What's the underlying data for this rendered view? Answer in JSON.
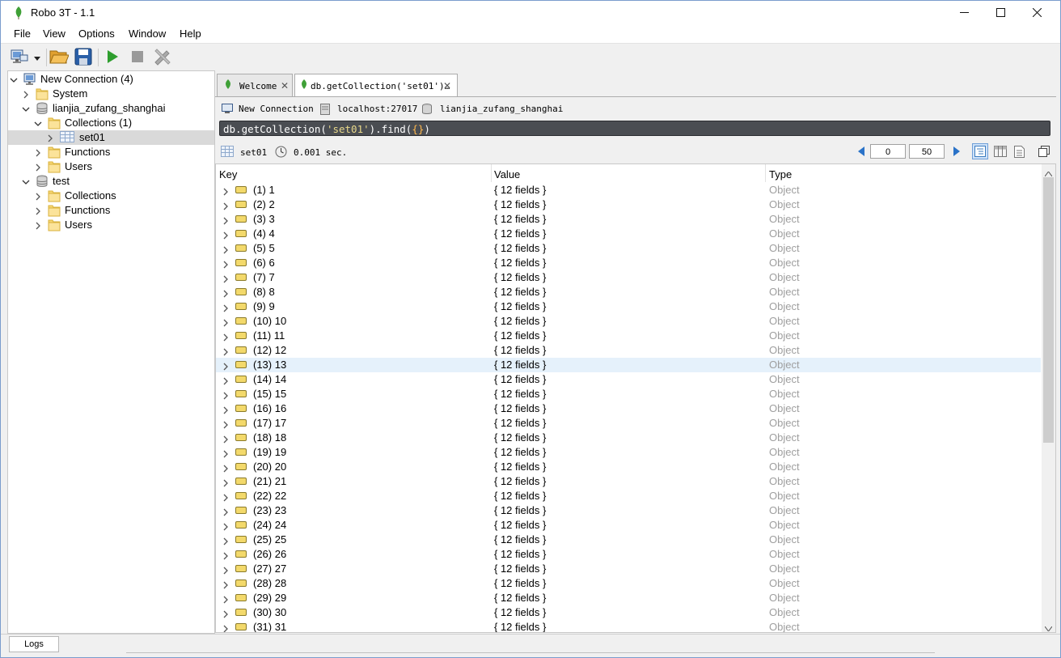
{
  "window": {
    "title": "Robo 3T - 1.1"
  },
  "menu": [
    "File",
    "View",
    "Options",
    "Window",
    "Help"
  ],
  "tree": [
    {
      "label": "New Connection (4)",
      "icon": "server-icon",
      "chev": "down",
      "indent": 0
    },
    {
      "label": "System",
      "icon": "folder-icon",
      "chev": "right",
      "indent": 1
    },
    {
      "label": "lianjia_zufang_shanghai",
      "icon": "database-icon",
      "chev": "down",
      "indent": 1
    },
    {
      "label": "Collections (1)",
      "icon": "folder-icon",
      "chev": "down",
      "indent": 2
    },
    {
      "label": "set01",
      "icon": "collection-icon",
      "chev": "right",
      "indent": 3,
      "selected": true
    },
    {
      "label": "Functions",
      "icon": "folder-icon",
      "chev": "right",
      "indent": 2
    },
    {
      "label": "Users",
      "icon": "folder-icon",
      "chev": "right",
      "indent": 2
    },
    {
      "label": "test",
      "icon": "database-icon",
      "chev": "down",
      "indent": 1
    },
    {
      "label": "Collections",
      "icon": "folder-icon",
      "chev": "right",
      "indent": 2
    },
    {
      "label": "Functions",
      "icon": "folder-icon",
      "chev": "right",
      "indent": 2
    },
    {
      "label": "Users",
      "icon": "folder-icon",
      "chev": "right",
      "indent": 2
    }
  ],
  "tabs": {
    "welcome": "Welcome",
    "query": "db.getCollection('set01')…"
  },
  "breadcrumb": {
    "connection": "New Connection",
    "host": "localhost:27017",
    "database": "lianjia_zufang_shanghai"
  },
  "query": {
    "prefix": "db.getCollection(",
    "collection": "'set01'",
    "suffix": ").find(",
    "cursor": "{}",
    "end": ")"
  },
  "results": {
    "collection": "set01",
    "time": "0.001 sec.",
    "page_start": "0",
    "page_size": "50",
    "columns": [
      "Key",
      "Value",
      "Type"
    ],
    "selected_row": 13,
    "rows": [
      {
        "key": "(1) 1",
        "value": "{ 12 fields }",
        "type": "Object"
      },
      {
        "key": "(2) 2",
        "value": "{ 12 fields }",
        "type": "Object"
      },
      {
        "key": "(3) 3",
        "value": "{ 12 fields }",
        "type": "Object"
      },
      {
        "key": "(4) 4",
        "value": "{ 12 fields }",
        "type": "Object"
      },
      {
        "key": "(5) 5",
        "value": "{ 12 fields }",
        "type": "Object"
      },
      {
        "key": "(6) 6",
        "value": "{ 12 fields }",
        "type": "Object"
      },
      {
        "key": "(7) 7",
        "value": "{ 12 fields }",
        "type": "Object"
      },
      {
        "key": "(8) 8",
        "value": "{ 12 fields }",
        "type": "Object"
      },
      {
        "key": "(9) 9",
        "value": "{ 12 fields }",
        "type": "Object"
      },
      {
        "key": "(10) 10",
        "value": "{ 12 fields }",
        "type": "Object"
      },
      {
        "key": "(11) 11",
        "value": "{ 12 fields }",
        "type": "Object"
      },
      {
        "key": "(12) 12",
        "value": "{ 12 fields }",
        "type": "Object"
      },
      {
        "key": "(13) 13",
        "value": "{ 12 fields }",
        "type": "Object"
      },
      {
        "key": "(14) 14",
        "value": "{ 12 fields }",
        "type": "Object"
      },
      {
        "key": "(15) 15",
        "value": "{ 12 fields }",
        "type": "Object"
      },
      {
        "key": "(16) 16",
        "value": "{ 12 fields }",
        "type": "Object"
      },
      {
        "key": "(17) 17",
        "value": "{ 12 fields }",
        "type": "Object"
      },
      {
        "key": "(18) 18",
        "value": "{ 12 fields }",
        "type": "Object"
      },
      {
        "key": "(19) 19",
        "value": "{ 12 fields }",
        "type": "Object"
      },
      {
        "key": "(20) 20",
        "value": "{ 12 fields }",
        "type": "Object"
      },
      {
        "key": "(21) 21",
        "value": "{ 12 fields }",
        "type": "Object"
      },
      {
        "key": "(22) 22",
        "value": "{ 12 fields }",
        "type": "Object"
      },
      {
        "key": "(23) 23",
        "value": "{ 12 fields }",
        "type": "Object"
      },
      {
        "key": "(24) 24",
        "value": "{ 12 fields }",
        "type": "Object"
      },
      {
        "key": "(25) 25",
        "value": "{ 12 fields }",
        "type": "Object"
      },
      {
        "key": "(26) 26",
        "value": "{ 12 fields }",
        "type": "Object"
      },
      {
        "key": "(27) 27",
        "value": "{ 12 fields }",
        "type": "Object"
      },
      {
        "key": "(28) 28",
        "value": "{ 12 fields }",
        "type": "Object"
      },
      {
        "key": "(29) 29",
        "value": "{ 12 fields }",
        "type": "Object"
      },
      {
        "key": "(30) 30",
        "value": "{ 12 fields }",
        "type": "Object"
      },
      {
        "key": "(31) 31",
        "value": "{ 12 fields }",
        "type": "Object"
      }
    ]
  },
  "statusbar": {
    "logs": "Logs"
  }
}
